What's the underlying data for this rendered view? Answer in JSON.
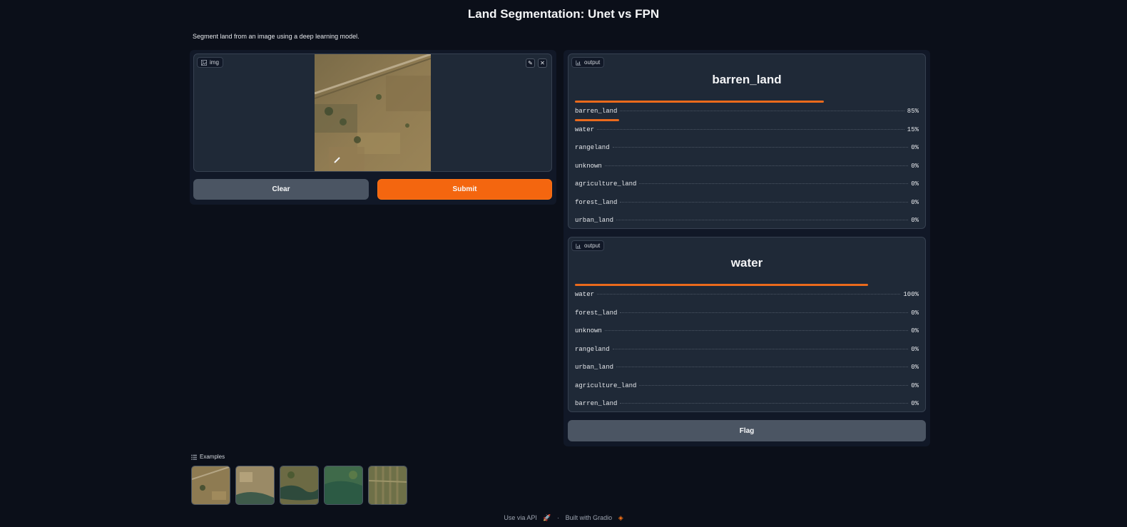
{
  "app": {
    "title": "Land Segmentation: Unet vs FPN",
    "description": "Segment land from an image using a deep learning model."
  },
  "input": {
    "label": "img",
    "clear_label": "Clear",
    "submit_label": "Submit"
  },
  "outputs": [
    {
      "label": "output",
      "title": "barren_land",
      "rows": [
        {
          "name": "barren_land",
          "value": "85%",
          "fraction": 0.85
        },
        {
          "name": "water",
          "value": "15%",
          "fraction": 0.15
        },
        {
          "name": "rangeland",
          "value": "0%",
          "fraction": 0
        },
        {
          "name": "unknown",
          "value": "0%",
          "fraction": 0
        },
        {
          "name": "agriculture_land",
          "value": "0%",
          "fraction": 0
        },
        {
          "name": "forest_land",
          "value": "0%",
          "fraction": 0
        },
        {
          "name": "urban_land",
          "value": "0%",
          "fraction": 0
        }
      ]
    },
    {
      "label": "output",
      "title": "water",
      "rows": [
        {
          "name": "water",
          "value": "100%",
          "fraction": 1.0
        },
        {
          "name": "forest_land",
          "value": "0%",
          "fraction": 0
        },
        {
          "name": "unknown",
          "value": "0%",
          "fraction": 0
        },
        {
          "name": "rangeland",
          "value": "0%",
          "fraction": 0
        },
        {
          "name": "urban_land",
          "value": "0%",
          "fraction": 0
        },
        {
          "name": "agriculture_land",
          "value": "0%",
          "fraction": 0
        },
        {
          "name": "barren_land",
          "value": "0%",
          "fraction": 0
        }
      ]
    }
  ],
  "flag_label": "Flag",
  "examples": {
    "label": "Examples",
    "count": 5
  },
  "footer": {
    "api_label": "Use via API",
    "separator": "·",
    "built_label": "Built with Gradio"
  },
  "colors": {
    "accent": "#f4660f",
    "background": "#0b0f19",
    "panel": "#1f2937"
  }
}
